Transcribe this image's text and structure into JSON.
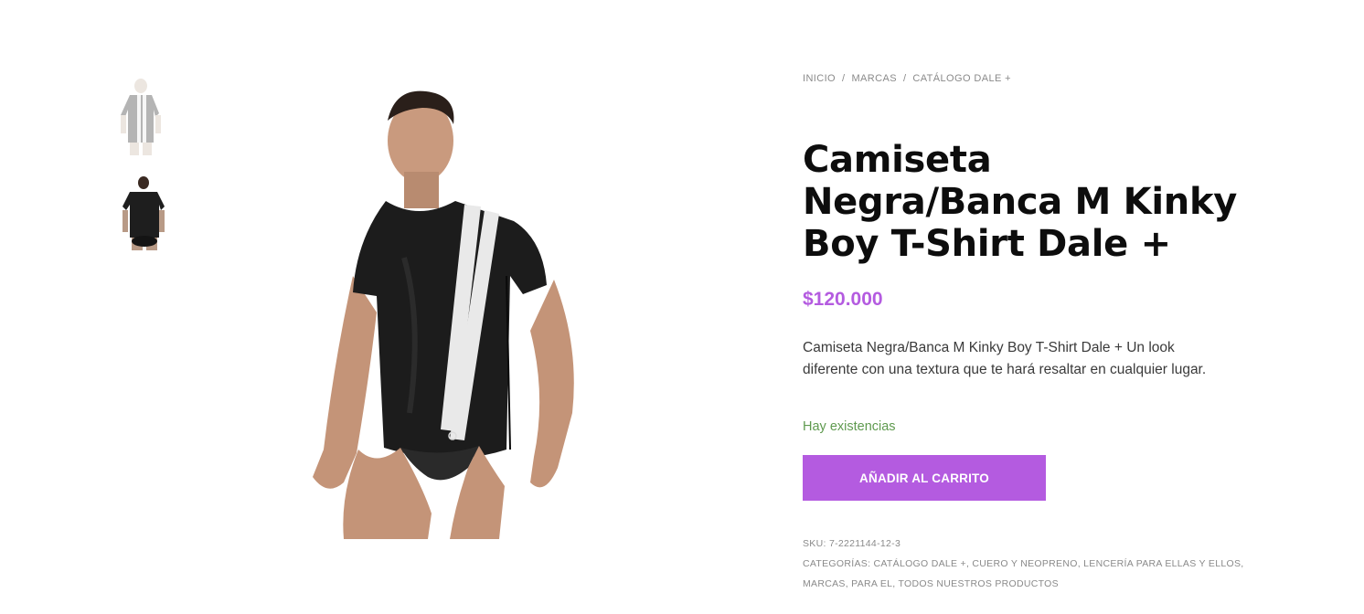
{
  "gallery": {
    "thumbnails": [
      {
        "name": "Front view",
        "selected": false
      },
      {
        "name": "Back view",
        "selected": true
      }
    ]
  },
  "breadcrumb": {
    "items": [
      "INICIO",
      "MARCAS",
      "CATÁLOGO DALE +"
    ],
    "separator": "/"
  },
  "product": {
    "title": "Camiseta Negra/Banca M Kinky Boy T-Shirt Dale +",
    "price": "$120.000",
    "description": "Camiseta Negra/Banca M Kinky Boy T-Shirt Dale + Un look diferente con una textura que te hará resaltar en cualquier lugar.",
    "stock_status": "Hay existencias",
    "add_to_cart_label": "AÑADIR AL CARRITO",
    "sku_label": "SKU:",
    "sku_value": "7-2221144-12-3",
    "categories_label": "CATEGORÍAS:",
    "categories": [
      "CATÁLOGO DALE +",
      "CUERO Y NEOPRENO",
      "LENCERÍA PARA ELLAS Y ELLOS",
      "MARCAS",
      "PARA EL",
      "TODOS NUESTROS PRODUCTOS"
    ]
  },
  "colors": {
    "accent": "#b45be0",
    "stock_green": "#5f9a4f",
    "muted": "#8a8a8a"
  }
}
